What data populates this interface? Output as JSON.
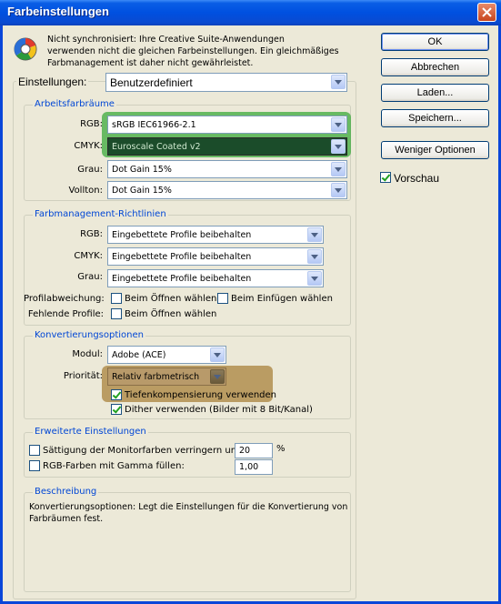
{
  "window": {
    "title": "Farbeinstellungen"
  },
  "info": {
    "text": "Nicht synchronisiert: Ihre Creative Suite-Anwendungen verwenden nicht die gleichen Farbeinstellungen. Ein gleichmäßiges Farbmanagement ist daher nicht gewährleistet.",
    "line1": "Nicht synchronisiert: Ihre Creative Suite-Anwendungen",
    "line2": "verwenden nicht die gleichen Farbeinstellungen. Ein gleichmäßiges",
    "line3": "Farbmanagement ist daher nicht gewährleistet."
  },
  "settings": {
    "label": "Einstellungen:",
    "value": "Benutzerdefiniert"
  },
  "workspaces": {
    "title": "Arbeitsfarbräume",
    "rgb": {
      "label": "RGB:",
      "value": "sRGB IEC61966-2.1"
    },
    "cmyk": {
      "label": "CMYK:",
      "value": "Euroscale Coated v2"
    },
    "gray": {
      "label": "Grau:",
      "value": "Dot Gain 15%"
    },
    "spot": {
      "label": "Vollton:",
      "value": "Dot Gain 15%"
    }
  },
  "policies": {
    "title": "Farbmanagement-Richtlinien",
    "rgb": {
      "label": "RGB:",
      "value": "Eingebettete Profile beibehalten"
    },
    "cmyk": {
      "label": "CMYK:",
      "value": "Eingebettete Profile beibehalten"
    },
    "gray": {
      "label": "Grau:",
      "value": "Eingebettete Profile beibehalten"
    },
    "mismatch_label": "Profilabweichung:",
    "mismatch_open": {
      "label": "Beim Öffnen wählen",
      "checked": false
    },
    "mismatch_paste": {
      "label": "Beim Einfügen wählen",
      "checked": false
    },
    "missing_label": "Fehlende Profile:",
    "missing_open": {
      "label": "Beim Öffnen wählen",
      "checked": false
    }
  },
  "conversion": {
    "title": "Konvertierungsoptionen",
    "engine": {
      "label": "Modul:",
      "value": "Adobe (ACE)"
    },
    "intent": {
      "label": "Priorität:",
      "value": "Relativ farbmetrisch"
    },
    "bpc": {
      "label": "Tiefenkompensierung verwenden",
      "checked": true
    },
    "dither": {
      "label": "Dither verwenden (Bilder mit 8 Bit/Kanal)",
      "checked": true
    }
  },
  "advanced": {
    "title": "Erweiterte Einstellungen",
    "desaturate": {
      "label": "Sättigung der Monitorfarben verringern um:",
      "value": "20",
      "unit": "%",
      "checked": false
    },
    "blend": {
      "label": "RGB-Farben mit Gamma füllen:",
      "value": "1,00",
      "checked": false
    }
  },
  "description": {
    "title": "Beschreibung",
    "line1": "Konvertierungsoptionen: Legt die Einstellungen für die Konvertierung von",
    "line2": "Farbräumen fest."
  },
  "buttons": {
    "ok": "OK",
    "cancel": "Abbrechen",
    "load": "Laden...",
    "save": "Speichern...",
    "fewer": "Weniger Optionen"
  },
  "preview": {
    "label": "Vorschau",
    "checked": true
  },
  "colors": {
    "titlebar": "#0a5ee6",
    "group_title": "#0046d5",
    "highlight_green": "#3caa3c",
    "highlight_brown": "#aa823c"
  }
}
